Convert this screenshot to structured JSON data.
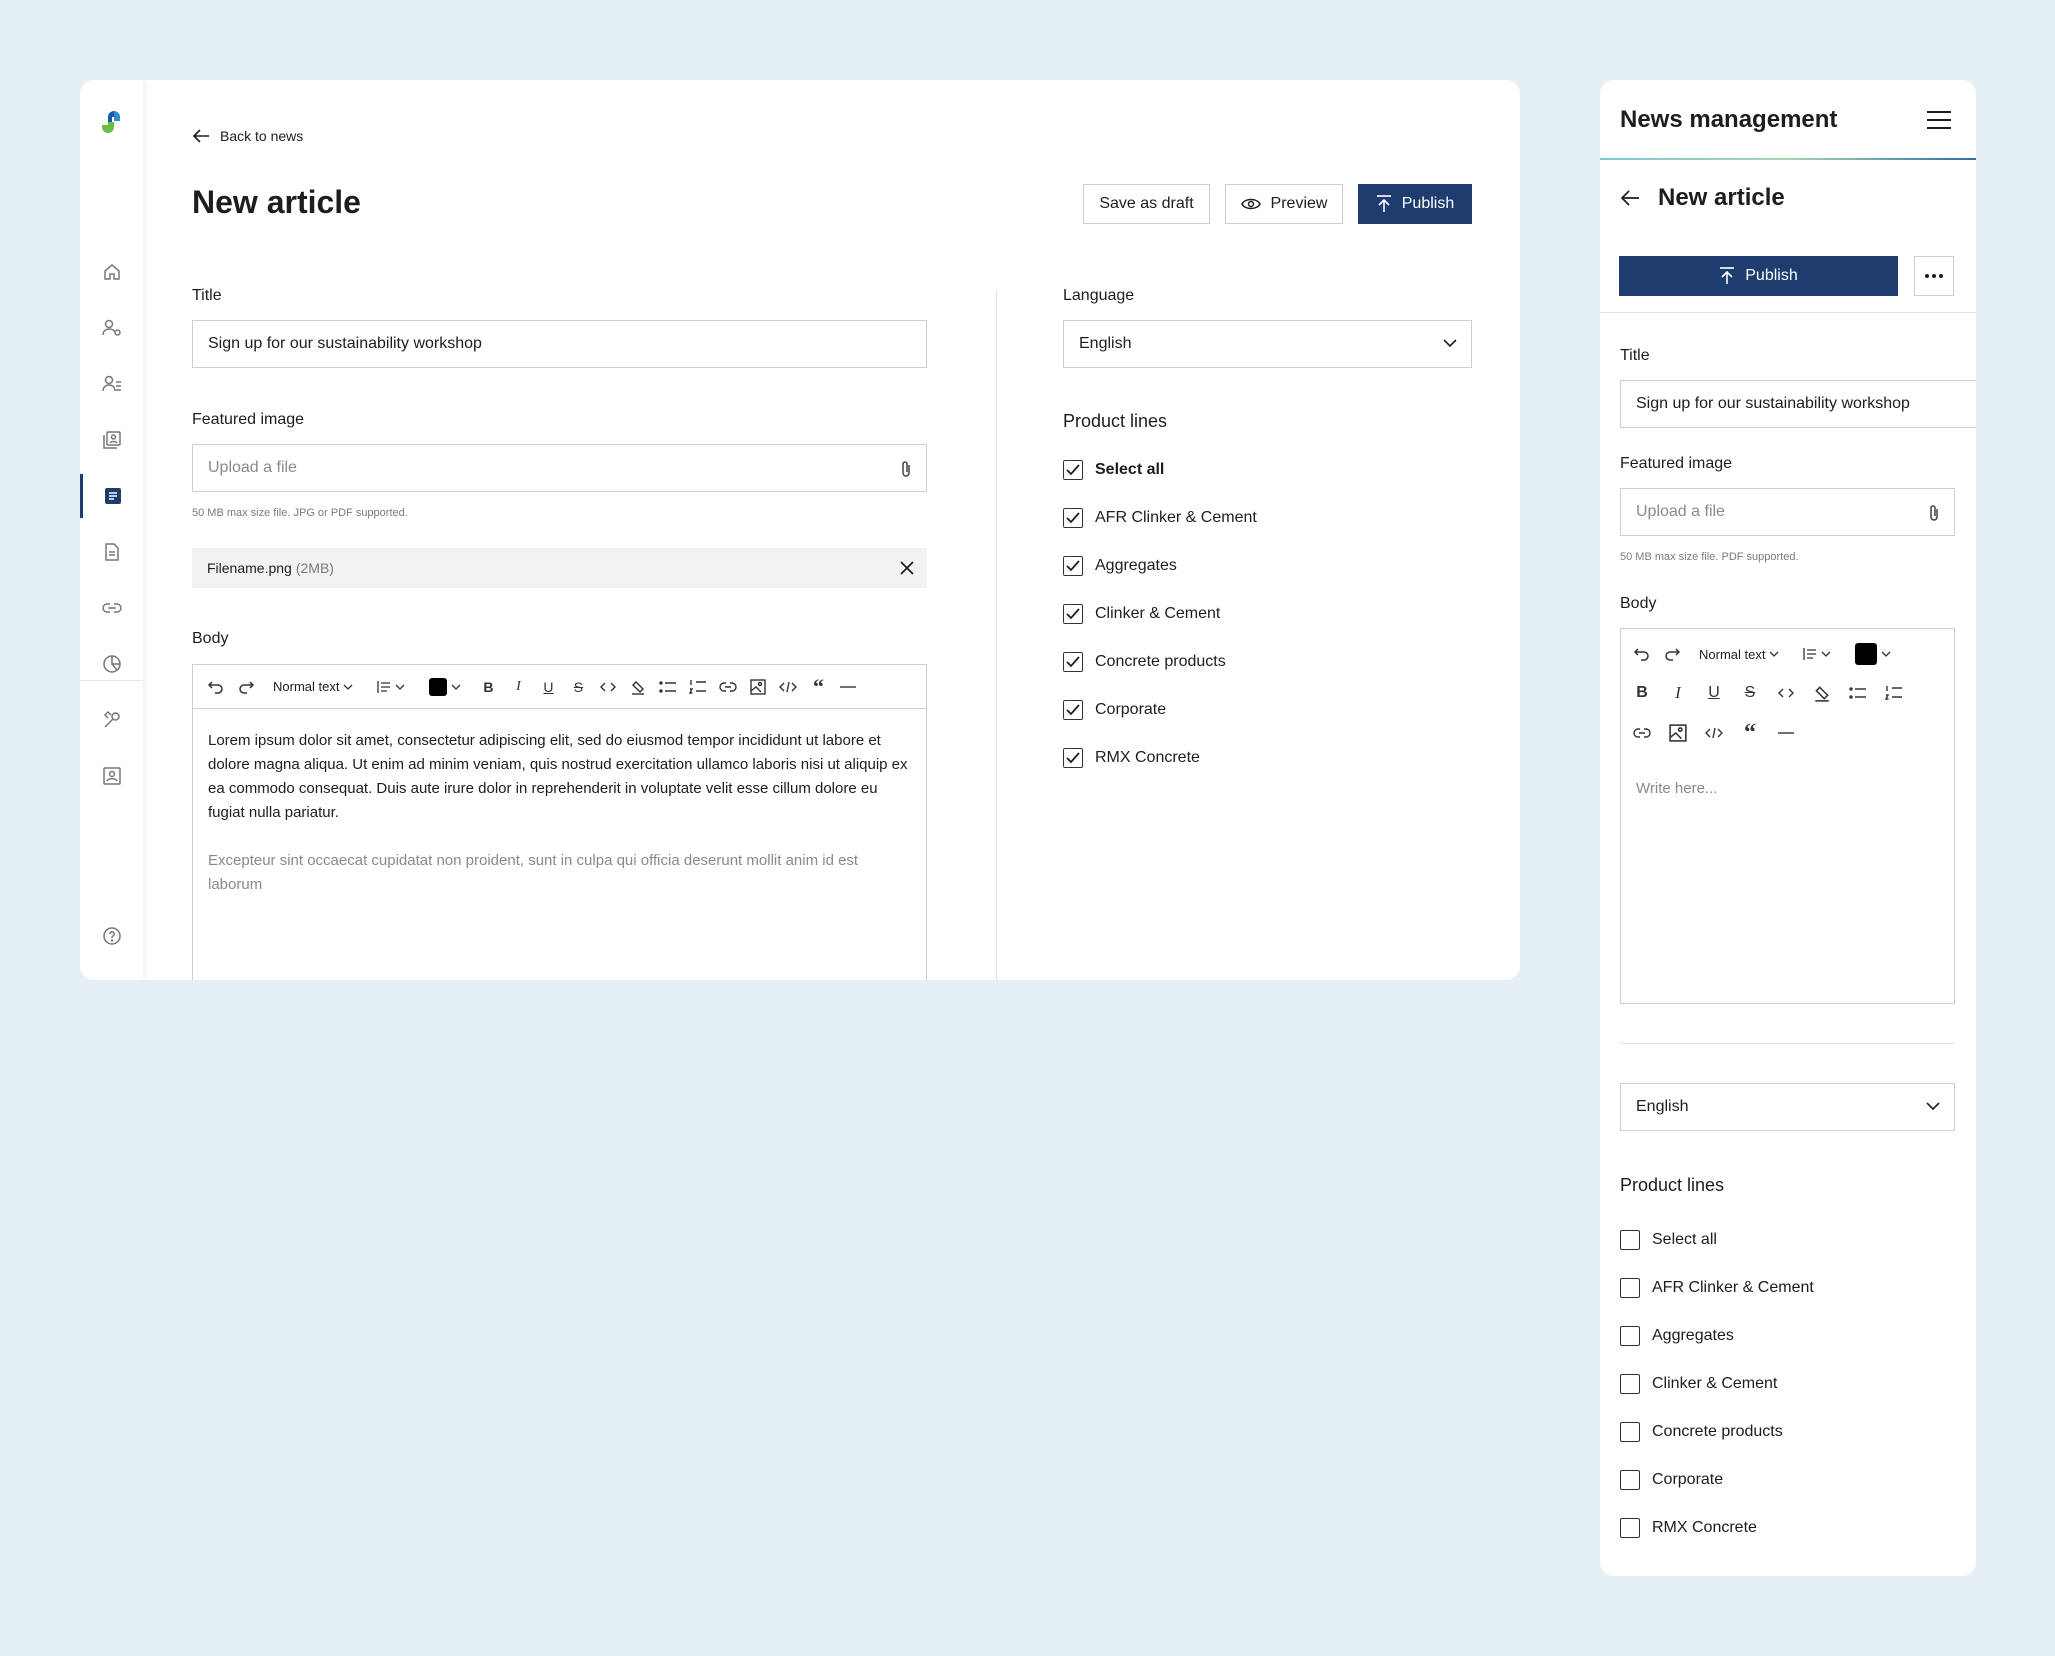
{
  "colors": {
    "background": "#e4f0f6",
    "primary": "#1f3c6e",
    "border": "#cfcfcf"
  },
  "desktop": {
    "back_label": "Back to news",
    "page_title": "New article",
    "buttons": {
      "save_draft": "Save as draft",
      "preview": "Preview",
      "publish": "Publish"
    },
    "nav_icons": [
      "home-icon",
      "user-settings-icon",
      "users-icon",
      "gallery-icon",
      "news-icon",
      "document-icon",
      "link-icon",
      "pie-chart-icon",
      "tools-icon",
      "contact-card-icon",
      "help-icon"
    ],
    "title_label": "Title",
    "title_value": "Sign up for our sustainability workshop",
    "featured_label": "Featured image",
    "upload_placeholder": "Upload a file",
    "upload_hint": "50 MB max size file. JPG or PDF supported.",
    "file_name": "Filename.png",
    "file_size": "(2MB)",
    "body_label": "Body",
    "text_style": "Normal text",
    "body_paragraph_1": "Lorem ipsum dolor sit amet, consectetur adipiscing elit, sed do eiusmod tempor incididunt ut labore et dolore magna aliqua. Ut enim ad minim veniam, quis nostrud exercitation ullamco laboris nisi ut aliquip ex ea commodo consequat. Duis aute irure dolor in reprehenderit in voluptate velit esse cillum dolore eu fugiat nulla pariatur.",
    "body_paragraph_2": "Excepteur sint occaecat cupidatat non proident, sunt in culpa qui officia deserunt mollit anim id est laborum",
    "language_label": "Language",
    "language_value": "English",
    "product_lines_label": "Product lines",
    "product_lines": [
      {
        "label": "Select all",
        "checked": true
      },
      {
        "label": "AFR Clinker & Cement",
        "checked": true
      },
      {
        "label": "Aggregates",
        "checked": true
      },
      {
        "label": "Clinker & Cement",
        "checked": true
      },
      {
        "label": "Concrete products",
        "checked": true
      },
      {
        "label": "Corporate",
        "checked": true
      },
      {
        "label": "RMX Concrete",
        "checked": true
      }
    ]
  },
  "mobile": {
    "app_title": "News management",
    "page_title": "New article",
    "publish_label": "Publish",
    "title_label": "Title",
    "title_value": "Sign up for our sustainability workshop",
    "featured_label": "Featured image",
    "upload_placeholder": "Upload a file",
    "upload_hint": "50 MB max size file. PDF supported.",
    "body_label": "Body",
    "text_style": "Normal text",
    "body_placeholder": "Write here...",
    "language_value": "English",
    "product_lines_label": "Product lines",
    "product_lines": [
      {
        "label": "Select all",
        "checked": false
      },
      {
        "label": "AFR Clinker & Cement",
        "checked": false
      },
      {
        "label": "Aggregates",
        "checked": false
      },
      {
        "label": "Clinker & Cement",
        "checked": false
      },
      {
        "label": "Concrete products",
        "checked": false
      },
      {
        "label": "Corporate",
        "checked": false
      },
      {
        "label": "RMX Concrete",
        "checked": false
      }
    ]
  }
}
